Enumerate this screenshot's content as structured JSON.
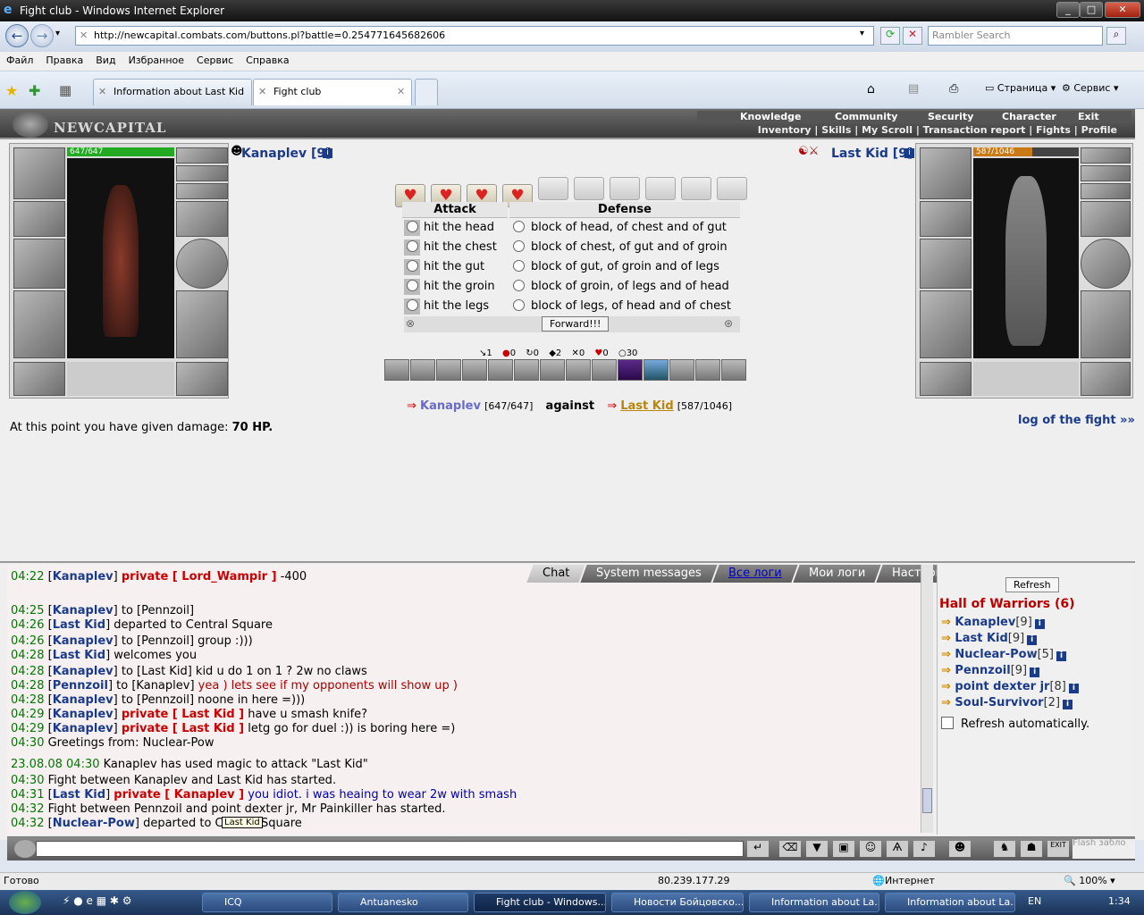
{
  "window": {
    "title": "Fight club - Windows Internet Explorer",
    "min": "_",
    "max": "□",
    "close": "✕"
  },
  "browser": {
    "url": "http://newcapital.combats.com/buttons.pl?battle=0.254771645682606",
    "search_placeholder": "Rambler Search",
    "menu": [
      "Файл",
      "Правка",
      "Вид",
      "Избранное",
      "Сервис",
      "Справка"
    ],
    "tabs": [
      {
        "label": "Information about Last Kid"
      },
      {
        "label": "Fight club"
      }
    ],
    "cmd_page": "Страница",
    "cmd_service": "Сервис"
  },
  "game": {
    "logo": "NEWCAPITAL",
    "nav_top": [
      "Knowledge",
      "Community",
      "Security",
      "Character",
      "Exit"
    ],
    "nav_bottom": [
      "Inventory",
      "Skills",
      "My Scroll",
      "Transaction report",
      "Fights",
      "Profile"
    ],
    "player": {
      "name": "Kanaplev [9]",
      "hp": "647/647",
      "hp_fraction": 1.0
    },
    "enemy": {
      "name": "Last Kid [9]",
      "hp": "587/1046",
      "hp_fraction": 0.56
    },
    "attack_header": "Attack",
    "defense_header": "Defense",
    "attack_options": [
      "hit the head",
      "hit the chest",
      "hit the gut",
      "hit the groin",
      "hit the legs"
    ],
    "defense_options": [
      "block of head, of chest and of gut",
      "block of chest, of gut and of groin",
      "block of gut, of groin and of legs",
      "block of groin, of legs and of head",
      "block of legs, of head and of chest"
    ],
    "forward_button": "Forward!!!",
    "hearts_filled": 4,
    "hearts_total": 10,
    "stats": [
      {
        "icon": "↘",
        "value": "1"
      },
      {
        "icon": "●",
        "value": "0"
      },
      {
        "icon": "↻",
        "value": "0"
      },
      {
        "icon": "◆",
        "value": "2"
      },
      {
        "icon": "✕",
        "value": "0"
      },
      {
        "icon": "♥",
        "value": "0"
      },
      {
        "icon": "○",
        "value": "30"
      }
    ],
    "vs": {
      "left_name": "Kanaplev",
      "left_hp": "[647/647]",
      "against": "against",
      "right_name": "Last Kid",
      "right_hp": "[587/1046]"
    },
    "damage_prefix": "At this point you have given damage: ",
    "damage_value": "70 HP.",
    "log_link": "log of the fight »»"
  },
  "chat": {
    "tabs": [
      "Chat",
      "System messages",
      "Все логи",
      "Мои логи",
      "Настройки"
    ],
    "lines": [
      {
        "time": "04:22",
        "name": "Kanaplev",
        "mid": "private [ Lord_Wampir ]",
        "msg": " -400"
      },
      {
        "time": "04:25",
        "name": "Kanaplev",
        "mid": "to [Pennzoil]",
        "msg": ""
      },
      {
        "time": "04:26",
        "name": "Last Kid",
        "mid": "",
        "msg": "departed to Central Square"
      },
      {
        "time": "04:26",
        "name": "Kanaplev",
        "mid": "to [Pennzoil]",
        "msg": "group :)))"
      },
      {
        "time": "04:28",
        "name": "Last Kid",
        "mid": "",
        "msg": "welcomes you"
      },
      {
        "time": "04:28",
        "name": "Kanaplev",
        "mid": "to [Last Kid]",
        "msg": "kid u do 1 on 1 ? 2w no claws"
      },
      {
        "time": "04:28",
        "name": "Pennzoil",
        "mid": "to [Kanaplev]",
        "msg": "yea ) lets see if my opponents will show up )"
      },
      {
        "time": "04:28",
        "name": "Kanaplev",
        "mid": "to [Pennzoil]",
        "msg": "noone in here =)))"
      },
      {
        "time": "04:29",
        "name": "Kanaplev",
        "mid": "private [ Last Kid ]",
        "msg": "have u smash knife?"
      },
      {
        "time": "04:29",
        "name": "Kanaplev",
        "mid": "private [ Last Kid ]",
        "msg": "letg go for duel :)) is boring here =)"
      },
      {
        "time": "04:30",
        "name": "",
        "mid": "",
        "msg": "Greetings from: Nuclear-Pow"
      },
      {
        "time": "23.08.08 04:30",
        "name": "",
        "mid": "",
        "msg": "Kanaplev has used magic to attack \"Last Kid\""
      },
      {
        "time": "04:30",
        "name": "",
        "mid": "",
        "msg": "Fight between Kanaplev and Last Kid has started."
      },
      {
        "time": "04:31",
        "name": "Last Kid",
        "mid": "private [ Kanaplev ]",
        "msg": "you idiot. i was heaing to wear 2w with smash"
      },
      {
        "time": "04:32",
        "name": "",
        "mid": "",
        "msg": "Fight between Pennzoil and point dexter jr, Mr Painkiller has started."
      },
      {
        "time": "04:32",
        "name": "Nuclear-Pow",
        "mid": "",
        "msg": "departed to Central Square"
      }
    ],
    "tooltip": "Last Kid"
  },
  "room": {
    "refresh": "Refresh",
    "title": "Hall of Warriors (6)",
    "warriors": [
      {
        "name": "Kanaplev",
        "level": "[9]"
      },
      {
        "name": "Last Kid",
        "level": "[9]"
      },
      {
        "name": "Nuclear-Pow",
        "level": "[5]"
      },
      {
        "name": "Pennzoil",
        "level": "[9]"
      },
      {
        "name": "point dexter jr",
        "level": "[8]"
      },
      {
        "name": "Soul-Survivor",
        "level": "[2]"
      }
    ],
    "auto_refresh": "Refresh automatically."
  },
  "statusbar": {
    "left": "Готово",
    "ip": "80.239.177.29",
    "zone": "Интернет",
    "zoom": "100%"
  },
  "taskbar": {
    "items": [
      "ICQ",
      "Antuanesko",
      "Fight club - Windows...",
      "Новости Бойцовско...",
      "Information about La...",
      "Information about La..."
    ],
    "lang": "EN",
    "time": "1:34",
    "flash": "Flash забло"
  }
}
